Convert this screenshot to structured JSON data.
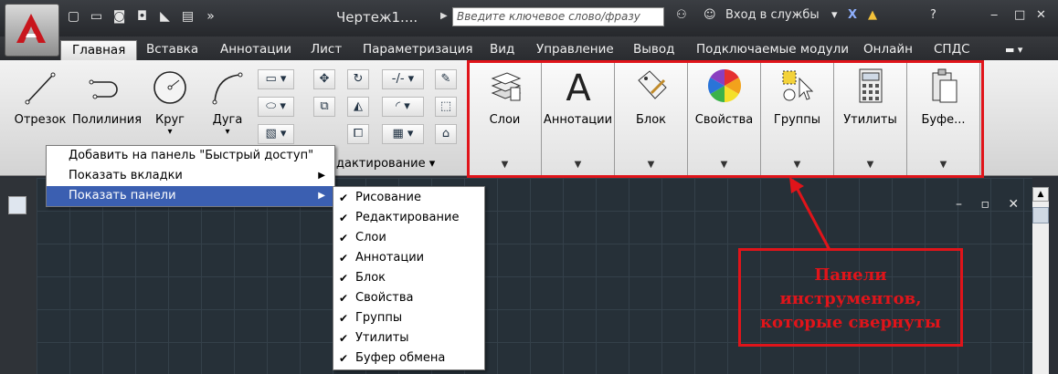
{
  "title_bar": {
    "doc_title": "Чертеж1....",
    "search_placeholder": "Введите ключевое слово/фразу",
    "signin": "Вход в службы"
  },
  "tabs": [
    "Главная",
    "Вставка",
    "Аннотации",
    "Лист",
    "Параметризация",
    "Вид",
    "Управление",
    "Вывод",
    "Подключаемые модули",
    "Онлайн",
    "СПДС"
  ],
  "draw_tools": [
    "Отрезок",
    "Полилиния",
    "Круг",
    "Дуга"
  ],
  "edit_panel_title": "дактирование",
  "collapsed_panels": [
    "Слои",
    "Аннотации",
    "Блок",
    "Свойства",
    "Группы",
    "Утилиты",
    "Буфе..."
  ],
  "context_menu": {
    "items": [
      "Добавить на панель \"Быстрый доступ\"",
      "Показать вкладки",
      "Показать панели"
    ],
    "selected_index": 2
  },
  "panels_submenu": {
    "items": [
      "Рисование",
      "Редактирование",
      "Слои",
      "Аннотации",
      "Блок",
      "Свойства",
      "Группы",
      "Утилиты",
      "Буфер обмена"
    ]
  },
  "annotation": {
    "lines": [
      "Панели",
      "инструментов,",
      "которые свернуты"
    ],
    "color": "#e0141a"
  }
}
